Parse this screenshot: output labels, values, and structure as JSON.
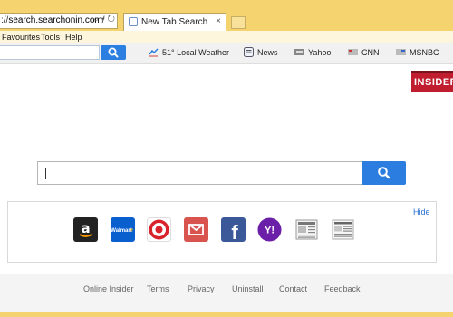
{
  "browser": {
    "url_prefix": "://",
    "url_domain": "search.searchonin.com",
    "url_suffix": "/",
    "address_tools": "⌕ ▾ ↻",
    "tab_title": "New Tab Search",
    "tab_close": "×",
    "menu": [
      "Favourites",
      "Tools",
      "Help"
    ]
  },
  "toolbar": {
    "links": [
      {
        "label": "51° Local Weather",
        "icon": "weather-icon"
      },
      {
        "label": "News",
        "icon": "news-icon"
      },
      {
        "label": "Yahoo",
        "icon": "yahoo-icon"
      },
      {
        "label": "CNN",
        "icon": "cnn-icon"
      },
      {
        "label": "MSNBC",
        "icon": "msnbc-icon"
      }
    ]
  },
  "logo": {
    "text": "INSIDER"
  },
  "main_search": {
    "value": ""
  },
  "shortcuts": {
    "hide_label": "Hide",
    "tiles": [
      {
        "name": "Amazon",
        "icon": "amazon-icon",
        "color": "#222222",
        "glyph": "a"
      },
      {
        "name": "Walmart",
        "icon": "walmart-icon",
        "color": "#0a5fcf",
        "glyph": "Walmart ✳"
      },
      {
        "name": "Target",
        "icon": "target-icon",
        "color": "#d8232a",
        "glyph": ""
      },
      {
        "name": "Mail",
        "icon": "mail-icon",
        "color": "#d9534f",
        "glyph": "✉"
      },
      {
        "name": "Facebook",
        "icon": "facebook-icon",
        "color": "#3b5998",
        "glyph": "f"
      },
      {
        "name": "Yahoo",
        "icon": "yahoo-icon",
        "color": "#6b1fa8",
        "glyph": "Y!"
      },
      {
        "name": "News 1",
        "icon": "newspaper-icon",
        "color": "#cfcfcf",
        "glyph": ""
      },
      {
        "name": "News 2",
        "icon": "newspaper-icon",
        "color": "#cfcfcf",
        "glyph": ""
      }
    ]
  },
  "footer": {
    "links": [
      "Online Insider",
      "Terms",
      "Privacy",
      "Uninstall",
      "Contact",
      "Feedback"
    ]
  },
  "colors": {
    "chrome_yellow": "#f5d36f",
    "accent_blue": "#2b7de0",
    "logo_red": "#c01e2e"
  }
}
